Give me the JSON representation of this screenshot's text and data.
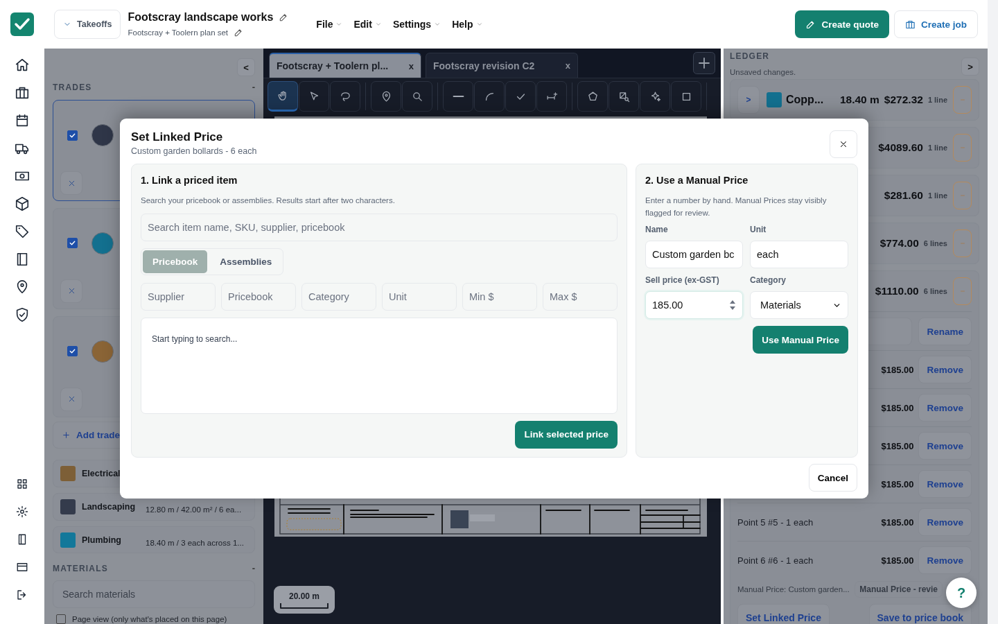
{
  "header": {
    "mode_button": "Takeoffs",
    "title": "Footscray landscape works",
    "subtitle": "Footscray + Toolern plan set",
    "menus": [
      "File",
      "Edit",
      "Settings",
      "Help"
    ],
    "actions": [
      {
        "label": "Create quote",
        "kind": "primary"
      },
      {
        "label": "Create job",
        "kind": "secondary"
      }
    ]
  },
  "trades_panel": {
    "collapse": "<",
    "heading": "TRADES",
    "heading_toggle": "-",
    "cards": [
      {
        "color": "#2f3648",
        "checked": true,
        "selected": true
      },
      {
        "color": "#13708f",
        "checked": true,
        "selected": false
      },
      {
        "color": "#8a6436",
        "checked": true,
        "selected": false
      }
    ],
    "add_trade": "Add trade",
    "rows": [
      {
        "name": "Electrical",
        "color": "#7d5f37"
      },
      {
        "name": "Landscaping",
        "summary": "12.80 m / 42.00 m² / 6 ea...",
        "color": "#343b4c"
      },
      {
        "name": "Plumbing",
        "summary": "18.40 m / 3 each across 1...",
        "color": "#13789a"
      }
    ],
    "materials_heading": "MATERIALS",
    "materials_toggle": "-",
    "materials_placeholder": "Search materials",
    "page_view": {
      "label": "Page view (only what's placed on this page)",
      "checked": false
    }
  },
  "canvas": {
    "tabs": [
      {
        "label": "Footscray + Toolern pl...",
        "close": "x",
        "selected": true
      },
      {
        "label": "Footscray revision C2",
        "close": "x",
        "selected": false
      }
    ],
    "tool_groups": [
      [
        {
          "kind": "hand",
          "selected": true
        },
        {
          "kind": "pointer",
          "selected": false
        },
        {
          "kind": "lasso",
          "selected": false
        }
      ],
      [
        {
          "kind": "pin",
          "selected": false
        },
        {
          "kind": "zoom",
          "selected": false
        }
      ],
      [
        {
          "kind": "line",
          "selected": false
        },
        {
          "kind": "arc",
          "selected": false
        },
        {
          "kind": "check",
          "selected": false
        },
        {
          "kind": "measure",
          "selected": false
        }
      ],
      [
        {
          "kind": "polygon",
          "selected": false
        },
        {
          "kind": "fill",
          "selected": false
        },
        {
          "kind": "sparkle",
          "selected": false
        },
        {
          "kind": "square",
          "selected": false
        }
      ]
    ],
    "scale": "20.00 m"
  },
  "ledger": {
    "heading": "LEDGER",
    "status": "Unsaved changes.",
    "toggle": ">",
    "groups": [
      {
        "expand": ">",
        "color": "#13708f",
        "name": "Copp...",
        "quantity": "18.40 m",
        "total": "$272.32",
        "lines": "1 line"
      },
      {
        "total": "$4089.60",
        "lines": "1 line"
      },
      {
        "total": "$281.60",
        "lines": "1 line"
      },
      {
        "total": "$774.00",
        "lines": "6 lines"
      },
      {
        "total": "$1110.00",
        "lines": "6 lines"
      }
    ],
    "rename_button": "Rename",
    "points": [
      {
        "price": "$185.00",
        "action": "Remove"
      },
      {
        "price": "$185.00",
        "action": "Remove"
      },
      {
        "price": "$185.00",
        "action": "Remove"
      },
      {
        "price": "$185.00",
        "action": "Remove"
      },
      {
        "label": "Point 5 #5 - 1 each",
        "price": "$185.00",
        "action": "Remove"
      },
      {
        "label": "Point 6 #6 - 1 each",
        "price": "$185.00",
        "action": "Remove"
      }
    ],
    "manual_note": "Manual Price: Custom garden...",
    "badge": "Manual Price - revie",
    "buttons": [
      "Set Linked Price",
      "Save to price book"
    ]
  },
  "help": "?",
  "dialog": {
    "title": "Set Linked Price",
    "subtitle": "Custom garden bollards - 6 each",
    "link": {
      "heading": "1. Link a priced item",
      "hint": "Search your pricebook or assemblies. Results start after two characters.",
      "search_placeholder": "Search item name, SKU, supplier, pricebook",
      "tabs": [
        {
          "label": "Pricebook",
          "selected": true
        },
        {
          "label": "Assemblies",
          "selected": false
        }
      ],
      "filters": [
        {
          "placeholder": "Supplier"
        },
        {
          "placeholder": "Pricebook"
        },
        {
          "placeholder": "Category"
        },
        {
          "placeholder": "Unit"
        },
        {
          "placeholder": "Min $"
        },
        {
          "placeholder": "Max $"
        }
      ],
      "results_empty": "Start typing to search...",
      "submit": "Link selected price"
    },
    "manual": {
      "heading": "2. Use a Manual Price",
      "hint": "Enter a number by hand. Manual Prices stay visibly flagged for review.",
      "fields": [
        {
          "label": "Name",
          "value": "Custom garden bc",
          "kind": "text"
        },
        {
          "label": "Unit",
          "value": "each",
          "kind": "text"
        },
        {
          "label": "Sell price (ex-GST)",
          "value": "185.00",
          "kind": "number"
        },
        {
          "label": "Category",
          "value": "Materials",
          "kind": "select"
        }
      ],
      "submit": "Use Manual Price"
    },
    "cancel": "Cancel"
  }
}
